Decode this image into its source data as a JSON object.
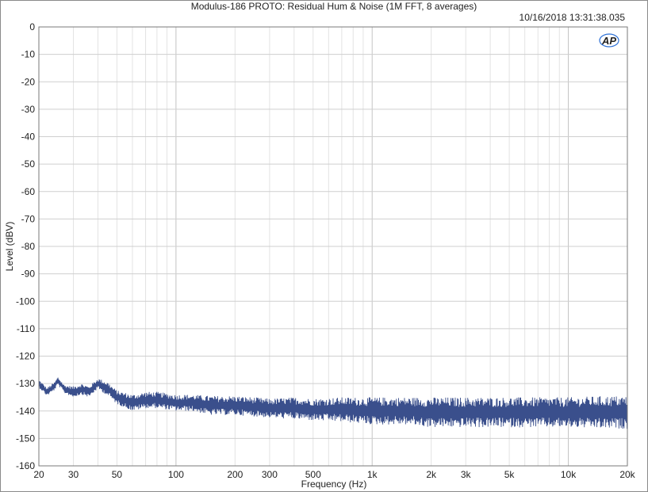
{
  "chart_data": {
    "type": "line",
    "title": "Modulus-186 PROTO: Residual Hum & Noise (1M FFT, 8 averages)",
    "timestamp": "10/16/2018 13:31:38.035",
    "logo": "AP",
    "xlabel": "Frequency (Hz)",
    "ylabel": "Level (dBV)",
    "xscale": "log",
    "xlim": [
      20,
      20000
    ],
    "ylim": [
      -160,
      0
    ],
    "grid": true,
    "x_ticks": [
      {
        "value": 20,
        "label": "20"
      },
      {
        "value": 30,
        "label": "30"
      },
      {
        "value": 50,
        "label": "50"
      },
      {
        "value": 100,
        "label": "100"
      },
      {
        "value": 200,
        "label": "200"
      },
      {
        "value": 300,
        "label": "300"
      },
      {
        "value": 500,
        "label": "500"
      },
      {
        "value": 1000,
        "label": "1k"
      },
      {
        "value": 2000,
        "label": "2k"
      },
      {
        "value": 3000,
        "label": "3k"
      },
      {
        "value": 5000,
        "label": "5k"
      },
      {
        "value": 10000,
        "label": "10k"
      },
      {
        "value": 20000,
        "label": "20k"
      }
    ],
    "y_ticks": [
      0,
      -10,
      -20,
      -30,
      -40,
      -50,
      -60,
      -70,
      -80,
      -90,
      -100,
      -110,
      -120,
      -130,
      -140,
      -150,
      -160
    ],
    "series": [
      {
        "color": "#3a4f8c",
        "x": [
          20,
          22,
          24,
          25,
          27,
          30,
          33,
          36,
          40,
          45,
          50,
          60,
          70,
          80,
          100,
          120,
          150,
          200,
          250,
          300,
          400,
          500,
          700,
          1000,
          1500,
          2000,
          3000,
          5000,
          7000,
          10000,
          15000,
          20000
        ],
        "y": [
          -130,
          -133,
          -131,
          -129,
          -132,
          -133,
          -132,
          -133,
          -130,
          -132,
          -135,
          -137,
          -136,
          -136,
          -137,
          -137,
          -138,
          -138,
          -138.5,
          -139,
          -139,
          -139.5,
          -139.5,
          -140,
          -140,
          -140.5,
          -140.5,
          -140.5,
          -140.5,
          -140.5,
          -140.5,
          -140.5
        ],
        "spread": [
          1.5,
          1.5,
          1.5,
          1.5,
          1.5,
          2,
          2,
          2,
          2,
          2.5,
          2.5,
          3,
          3,
          3,
          3,
          3,
          3.5,
          3.5,
          3.5,
          3.5,
          4,
          4,
          4.5,
          5,
          5,
          5.5,
          5.5,
          5.5,
          5.5,
          5.5,
          6,
          6
        ]
      }
    ]
  }
}
